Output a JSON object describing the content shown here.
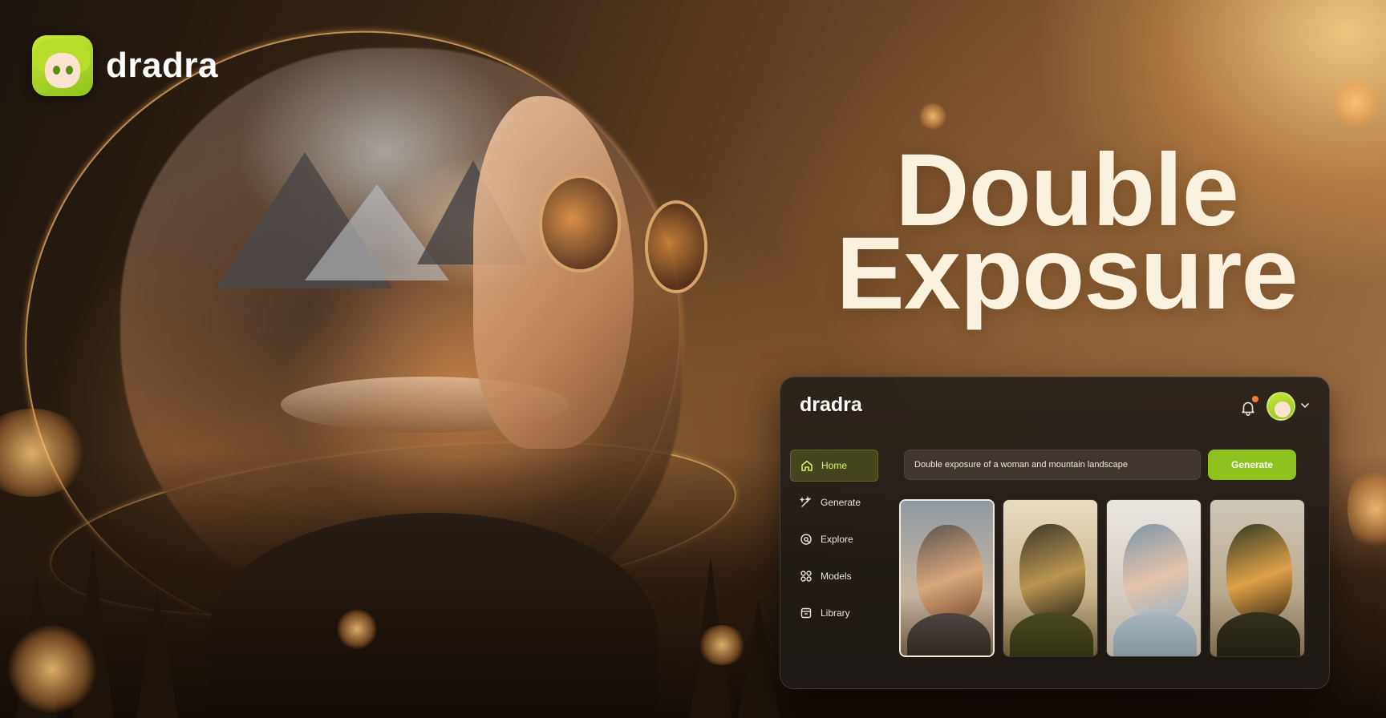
{
  "brand": {
    "name": "dradra",
    "icon": "anime-avatar-icon"
  },
  "headline": {
    "line1": "Double",
    "line2": "Exposure"
  },
  "window": {
    "logo": "dradra",
    "icons": {
      "notifications": "bell-icon",
      "profile": "avatar",
      "menu": "chevron-down-icon"
    },
    "nav": {
      "items": [
        {
          "label": "Home",
          "icon": "home-icon",
          "active": true
        },
        {
          "label": "Generate",
          "icon": "generate-icon",
          "active": false
        },
        {
          "label": "Explore",
          "icon": "explore-icon",
          "active": false
        },
        {
          "label": "Models",
          "icon": "models-icon",
          "active": false
        },
        {
          "label": "Library",
          "icon": "library-icon",
          "active": false
        }
      ]
    },
    "prompt": {
      "value": "Double exposure of a woman and mountain landscape"
    },
    "generate_label": "Generate",
    "gallery": {
      "selected_index": 0,
      "count": 4
    }
  },
  "colors": {
    "accent": "#8fc21e",
    "accent_text": "#d8f46a",
    "headline": "#fbf1df",
    "notification_dot": "#ff7a2f"
  }
}
